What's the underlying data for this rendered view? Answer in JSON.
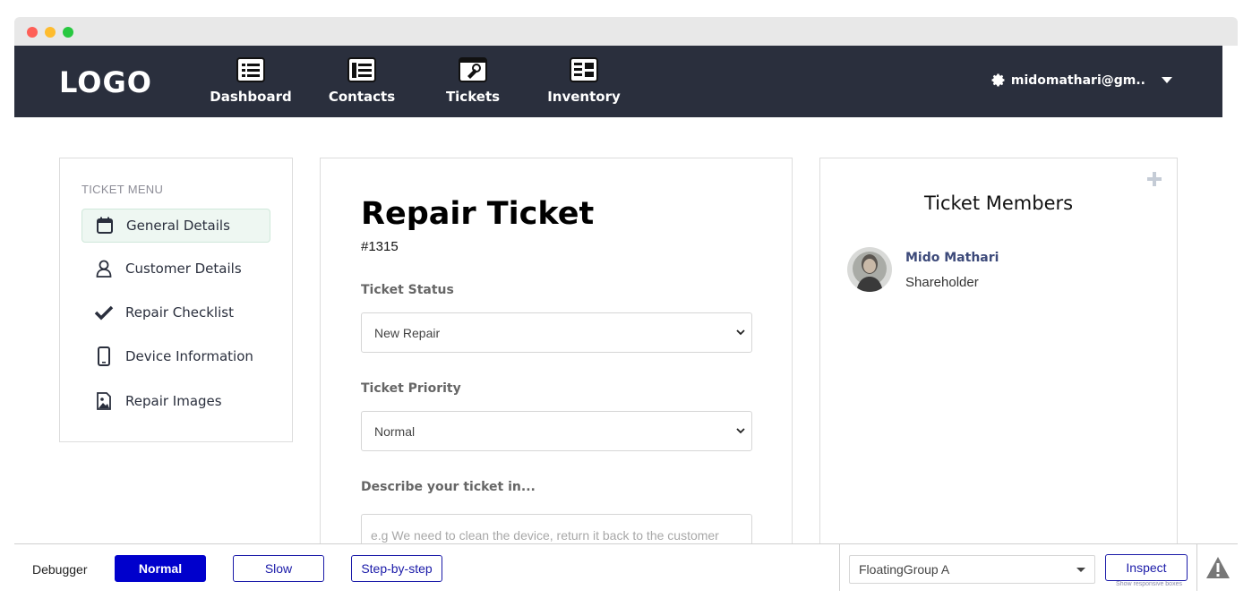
{
  "navbar": {
    "logo": "LOGO",
    "items": [
      {
        "label": "Dashboard",
        "icon": "dashboard-icon"
      },
      {
        "label": "Contacts",
        "icon": "contacts-icon"
      },
      {
        "label": "Tickets",
        "icon": "tickets-icon"
      },
      {
        "label": "Inventory",
        "icon": "inventory-icon"
      }
    ],
    "user": "midomathari@gm..",
    "user_icon": "gear-icon"
  },
  "ticket_menu": {
    "title": "TICKET MENU",
    "items": [
      {
        "label": "General Details",
        "icon": "calendar-icon",
        "active": true
      },
      {
        "label": "Customer Details",
        "icon": "user-icon",
        "active": false
      },
      {
        "label": "Repair Checklist",
        "icon": "checkmark-icon",
        "active": false
      },
      {
        "label": "Device Information",
        "icon": "phone-icon",
        "active": false
      },
      {
        "label": "Repair Images",
        "icon": "image-icon",
        "active": false
      }
    ]
  },
  "ticket": {
    "title": "Repair Ticket",
    "number": "#1315",
    "status_label": "Ticket Status",
    "status_value": "New Repair",
    "priority_label": "Ticket Priority",
    "priority_value": "Normal",
    "description_label": "Describe your ticket in...",
    "description_placeholder": "e.g We need to clean the device, return it back to the customer"
  },
  "members": {
    "title": "Ticket Members",
    "list": [
      {
        "name": "Mido Mathari",
        "role": "Shareholder"
      }
    ]
  },
  "debugger": {
    "label": "Debugger",
    "modes": [
      "Normal",
      "Slow",
      "Step-by-step"
    ],
    "active_mode": "Normal",
    "group": "FloatingGroup A",
    "inspect": "Inspect",
    "inspect_hint": "Show responsive boxes"
  },
  "colors": {
    "navbar_bg": "#2a2f3d",
    "active_menu_bg": "#eef7f2",
    "member_name": "#3d4a7a",
    "debugger_accent": "#0000cc"
  }
}
